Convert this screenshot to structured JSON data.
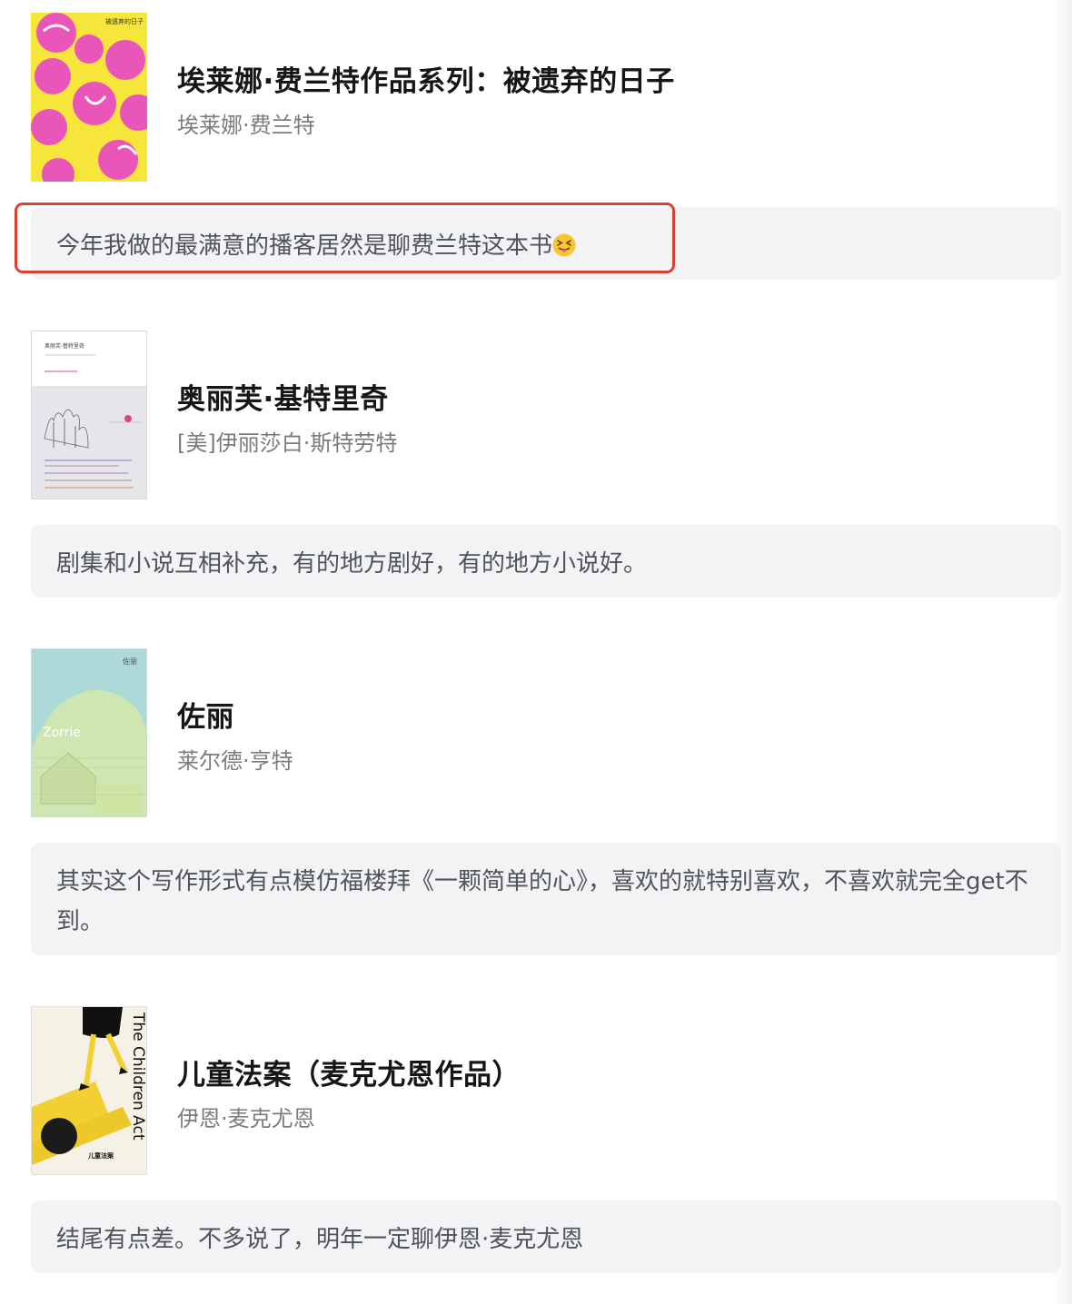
{
  "books": [
    {
      "title": "埃莱娜·费兰特作品系列：被遗弃的日子",
      "author": "埃莱娜·费兰特",
      "comment": "今年我做的最满意的播客居然是聊费兰特这本书",
      "comment_emoji": "squinting-tongue-emoji",
      "cover_text": "被遗弃的日子",
      "highlighted": true
    },
    {
      "title": "奥丽芙·基特里奇",
      "author": "[美]伊丽莎白·斯特劳特",
      "comment": "剧集和小说互相补充，有的地方剧好，有的地方小说好。",
      "cover_text": "奥丽芙·基特里奇",
      "highlighted": false
    },
    {
      "title": "佐丽",
      "author": "莱尔德·亨特",
      "comment": "其实这个写作形式有点模仿福楼拜《一颗简单的心》，喜欢的就特别喜欢，不喜欢就完全get不到。",
      "cover_text": "佐丽",
      "cover_text_en": "Zorrie",
      "highlighted": false
    },
    {
      "title": "儿童法案（麦克尤恩作品）",
      "author": "伊恩·麦克尤恩",
      "comment": "结尾有点差。不多说了，明年一定聊伊恩·麦克尤恩",
      "cover_text": "儿童法案",
      "cover_text_en": "The Children Act",
      "highlighted": false
    }
  ],
  "colors": {
    "highlight_border": "#d9422f",
    "comment_bg": "#f2f3f5",
    "title": "#161616",
    "author": "#7c7c7c"
  }
}
